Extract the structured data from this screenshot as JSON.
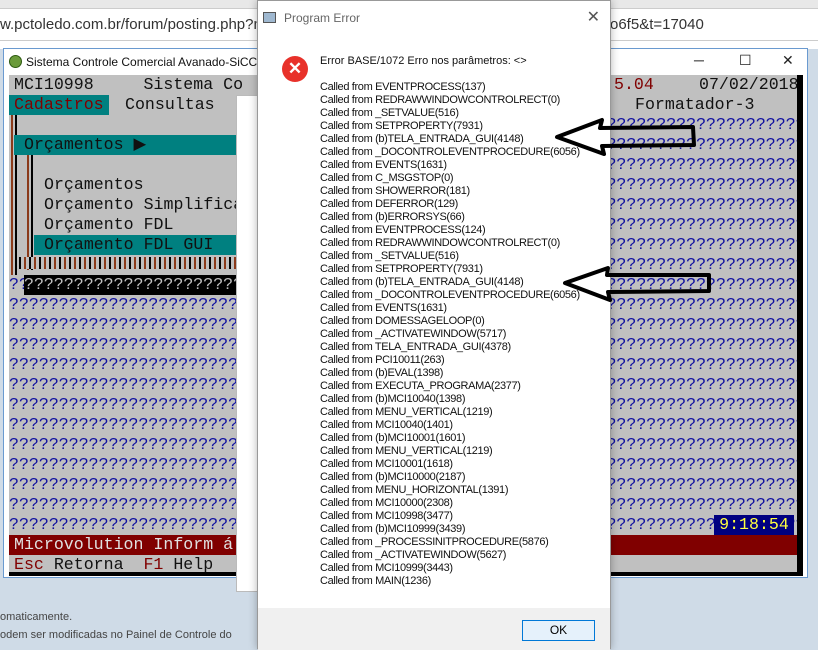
{
  "browser": {
    "url_left": "w.pctoledo.com.br/forum/posting.php?mo",
    "url_right": "o6f5&t=17040",
    "page_text_1": "omaticamente.",
    "page_text_2": "odem ser modificadas no Painel de Controle do"
  },
  "app": {
    "title": "Sistema Controle Comercial Avanado-SiCCA",
    "header_left": "MCI10998     Sistema Co",
    "header_mid": "5.04",
    "header_right": "07/02/2018",
    "menu": {
      "active": "Cadastros",
      "item2": "Consultas",
      "item_right": "Formatador-3"
    },
    "submenu_title": "Orçamentos ▶",
    "submenu_items": [
      "Orçamentos",
      "Orçamento Simplifica",
      "Orçamento FDL",
      "Orçamento FDL GUI"
    ],
    "fill": "??????????????????????????????????????????????????????????????????????????????????",
    "clock": "9:18:54",
    "status": "Microvolution Inform á",
    "keys": {
      "esc": "Esc",
      "esc_label": " Retorna  ",
      "f1": "F1",
      "f1_label": " Help"
    }
  },
  "dialog": {
    "title": "Program Error",
    "message": "Error BASE/1072  Erro nos parâmetros: <>",
    "ok": "OK",
    "calls": [
      "Called from EVENTPROCESS(137)",
      "Called from REDRAWWINDOWCONTROLRECT(0)",
      "Called from _SETVALUE(516)",
      "Called from SETPROPERTY(7931)",
      "Called from (b)TELA_ENTRADA_GUI(4148)",
      "Called from _DOCONTROLEVENTPROCEDURE(6056)",
      "Called from EVENTS(1631)",
      "Called from C_MSGSTOP(0)",
      "Called from SHOWERROR(181)",
      "Called from DEFERROR(129)",
      "Called from (b)ERRORSYS(66)",
      "Called from EVENTPROCESS(124)",
      "Called from REDRAWWINDOWCONTROLRECT(0)",
      "Called from _SETVALUE(516)",
      "Called from SETPROPERTY(7931)",
      "Called from (b)TELA_ENTRADA_GUI(4148)",
      "Called from _DOCONTROLEVENTPROCEDURE(6056)",
      "Called from EVENTS(1631)",
      "Called from DOMESSAGELOOP(0)",
      "Called from _ACTIVATEWINDOW(5717)",
      "Called from TELA_ENTRADA_GUI(4378)",
      "Called from PCI10011(263)",
      "Called from (b)EVAL(1398)",
      "Called from EXECUTA_PROGRAMA(2377)",
      "Called from (b)MCI10040(1398)",
      "Called from MENU_VERTICAL(1219)",
      "Called from MCI10040(1401)",
      "Called from (b)MCI10001(1601)",
      "Called from MENU_VERTICAL(1219)",
      "Called from MCI10001(1618)",
      "Called from (b)MCI10000(2187)",
      "Called from MENU_HORIZONTAL(1391)",
      "Called from MCI10000(2308)",
      "Called from MCI10998(3477)",
      "Called from (b)MCI10999(3439)",
      "Called from _PROCESSINITPROCEDURE(5876)",
      "Called from _ACTIVATEWINDOW(5627)",
      "Called from MCI10999(3443)",
      "Called from MAIN(1236)"
    ]
  }
}
